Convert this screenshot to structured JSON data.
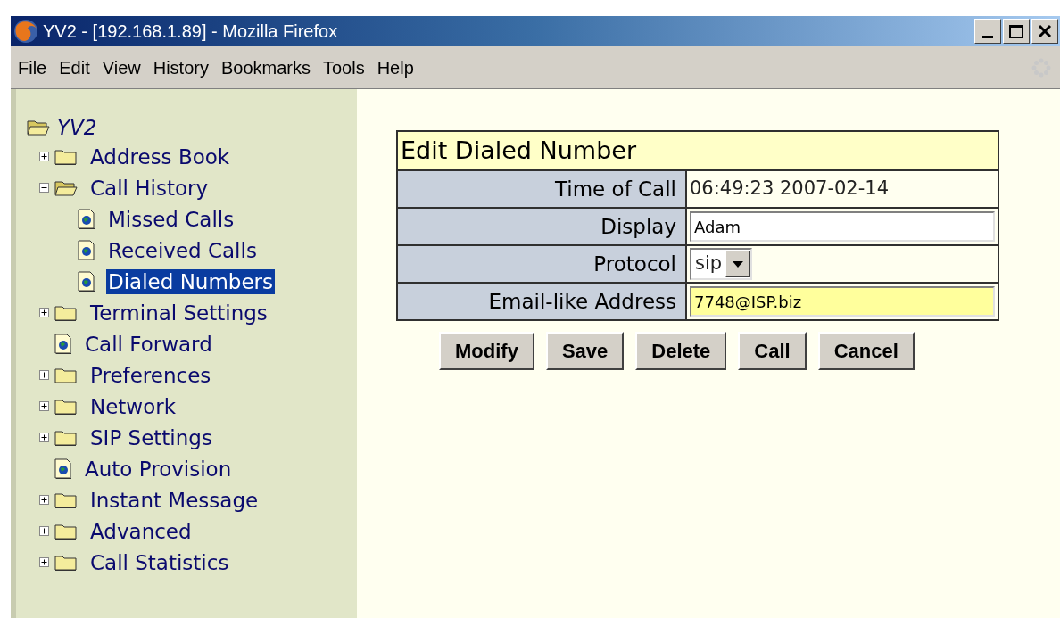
{
  "window": {
    "title": "YV2 - [192.168.1.89] - Mozilla Firefox"
  },
  "menu": [
    "File",
    "Edit",
    "View",
    "History",
    "Bookmarks",
    "Tools",
    "Help"
  ],
  "tree": {
    "label": "YV2",
    "expanded": true,
    "children": [
      {
        "kind": "folder",
        "label": "Address Book",
        "expanded": false,
        "selected": false
      },
      {
        "kind": "folder",
        "label": "Call History",
        "expanded": true,
        "selected": false,
        "children": [
          {
            "kind": "page",
            "label": "Missed Calls",
            "selected": false
          },
          {
            "kind": "page",
            "label": "Received Calls",
            "selected": false
          },
          {
            "kind": "page",
            "label": "Dialed Numbers",
            "selected": true
          }
        ]
      },
      {
        "kind": "folder",
        "label": "Terminal Settings",
        "expanded": false,
        "selected": false
      },
      {
        "kind": "page",
        "label": "Call Forward",
        "selected": false
      },
      {
        "kind": "folder",
        "label": "Preferences",
        "expanded": false,
        "selected": false
      },
      {
        "kind": "folder",
        "label": "Network",
        "expanded": false,
        "selected": false
      },
      {
        "kind": "folder",
        "label": "SIP Settings",
        "expanded": false,
        "selected": false
      },
      {
        "kind": "page",
        "label": "Auto Provision",
        "selected": false
      },
      {
        "kind": "folder",
        "label": "Instant Message",
        "expanded": false,
        "selected": false
      },
      {
        "kind": "folder",
        "label": "Advanced",
        "expanded": false,
        "selected": false
      },
      {
        "kind": "folder",
        "label": "Call Statistics",
        "expanded": false,
        "selected": false
      }
    ]
  },
  "form": {
    "title": "Edit Dialed Number",
    "fields": [
      {
        "kind": "text",
        "label": "Time of Call",
        "value": "06:49:23 2007-02-14"
      },
      {
        "kind": "input",
        "label": "Display",
        "value": "Adam",
        "highlighted": false
      },
      {
        "kind": "select",
        "label": "Protocol",
        "value": "sip"
      },
      {
        "kind": "input",
        "label": "Email-like Address",
        "value": "7748@ISP.biz",
        "highlighted": true
      }
    ]
  },
  "buttons": [
    "Modify",
    "Save",
    "Delete",
    "Call",
    "Cancel"
  ]
}
